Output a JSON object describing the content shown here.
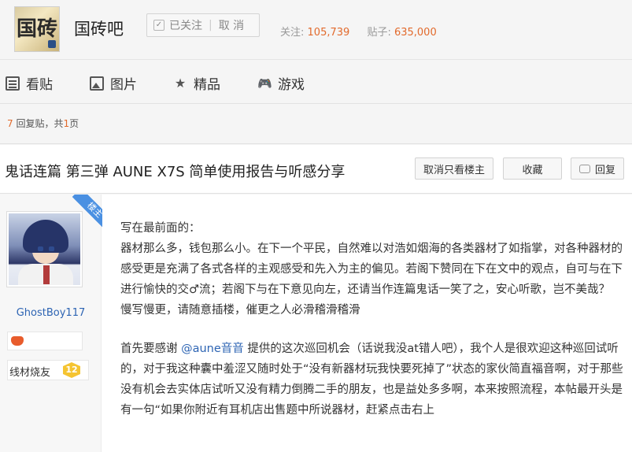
{
  "forum": {
    "logo_text": "国砖",
    "name": "国砖吧",
    "follow_label": "已关注",
    "unfollow_label": "取 消",
    "follow_check": "✓",
    "stats_follow_label": "关注:",
    "stats_follow_value": "105,739",
    "stats_posts_label": "贴子:",
    "stats_posts_value": "635,000"
  },
  "nav": {
    "items": [
      {
        "label": "看贴",
        "icon": "document-icon"
      },
      {
        "label": "图片",
        "icon": "picture-icon"
      },
      {
        "label": "精品",
        "icon": "star-icon"
      },
      {
        "label": "游戏",
        "icon": "gamepad-icon"
      }
    ],
    "star_glyph": "★",
    "gamepad_glyph": "🎮"
  },
  "reply_info": {
    "reply_count": "7",
    "reply_text": " 回复贴，共",
    "page_count": "1",
    "page_text": "页"
  },
  "thread": {
    "title": "鬼话连篇 第三弹 AUNE X7S 简单使用报告与听感分享",
    "btn_only_op": "取消只看楼主",
    "btn_collect": "收藏",
    "btn_reply": "回复"
  },
  "author": {
    "badge": "楼主",
    "name": "GhostBoy117",
    "level_title": "线材烧友",
    "level": "12"
  },
  "post": {
    "p1": "写在最前面的：",
    "p2": "器材那么多，钱包那么小。在下一个平民，自然难以对浩如烟海的各类器材了如指掌，对各种器材的感受更是充满了各式各样的主观感受和先入为主的偏见。若阁下赞同在下在文中的观点，自可与在下进行愉快的交♂流；若阁下与在下意见向左，还请当作连篇鬼话一笑了之，安心听歌，岂不美哉？",
    "p3": "慢写慢更，请随意插楼，催更之人必滑稽滑稽滑",
    "p4_before": "首先要感谢 ",
    "p4_mention": "@aune音音",
    "p4_after": " 提供的这次巡回机会（话说我没at错人吧），我个人是很欢迎这种巡回试听的，对于我这种囊中羞涩又随时处于“没有新器材玩我快要死掉了”状态的家伙简直福音啊，对于那些没有机会去实体店试听又没有精力倒腾二手的朋友，也是益处多多啊，本来按照流程，本帖最开头是有一句“如果你附近有耳机店出售题中所说器材，赶紧点击右上"
  }
}
